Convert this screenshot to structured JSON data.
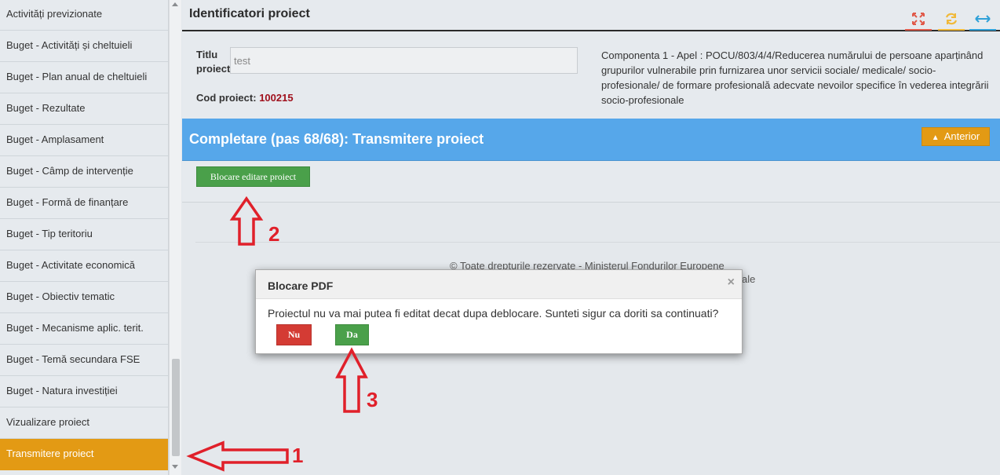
{
  "sidebar": {
    "items": [
      {
        "label": "Activități previzionate"
      },
      {
        "label": "Buget - Activități și cheltuieli"
      },
      {
        "label": "Buget - Plan anual de cheltuieli"
      },
      {
        "label": "Buget - Rezultate"
      },
      {
        "label": "Buget - Amplasament"
      },
      {
        "label": "Buget - Câmp de intervenție"
      },
      {
        "label": "Buget - Formă de finanțare"
      },
      {
        "label": "Buget - Tip teritoriu"
      },
      {
        "label": "Buget - Activitate economică"
      },
      {
        "label": "Buget - Obiectiv tematic"
      },
      {
        "label": "Buget - Mecanisme aplic. terit."
      },
      {
        "label": "Buget - Temă secundara FSE"
      },
      {
        "label": "Buget - Natura investiției"
      },
      {
        "label": "Vizualizare proiect"
      },
      {
        "label": "Transmitere proiect"
      }
    ],
    "active_index": 14,
    "active_color": "#e39a14"
  },
  "header": {
    "title": "Identificatori proiect"
  },
  "project": {
    "title_label_1": "Titlu",
    "title_label_2": "proiect",
    "title_value": "test",
    "code_label": "Cod proiect:",
    "code_value": "100215",
    "description": "Componenta 1 - Apel : POCU/803/4/4/Reducerea numărului de persoane aparținând grupurilor vulnerabile prin furnizarea unor servicii sociale/ medicale/ socio-profesionale/ de formare profesională adecvate nevoilor specifice în vederea integrării socio-profesionale"
  },
  "step": {
    "title": "Completare (pas 68/68): Transmitere proiect",
    "prev_label": "Anterior",
    "lock_button_label": "Blocare editare proiect",
    "bar_color": "#56a7ea"
  },
  "footer": {
    "line1": "© Toate drepturile rezervate - Ministerul Fondurilor Europene",
    "line2": "ale"
  },
  "modal": {
    "title": "Blocare PDF",
    "message": "Proiectul nu va mai putea fi editat decat dupa deblocare. Sunteti sigur ca doriti sa continuati?",
    "no_label": "Nu",
    "yes_label": "Da",
    "close_glyph": "×"
  },
  "annotations": {
    "step1": "1",
    "step2": "2",
    "step3": "3",
    "color": "#e0202a"
  },
  "icons": {
    "expand": "expand-icon",
    "refresh": "refresh-icon",
    "width": "arrows-horizontal-icon"
  }
}
